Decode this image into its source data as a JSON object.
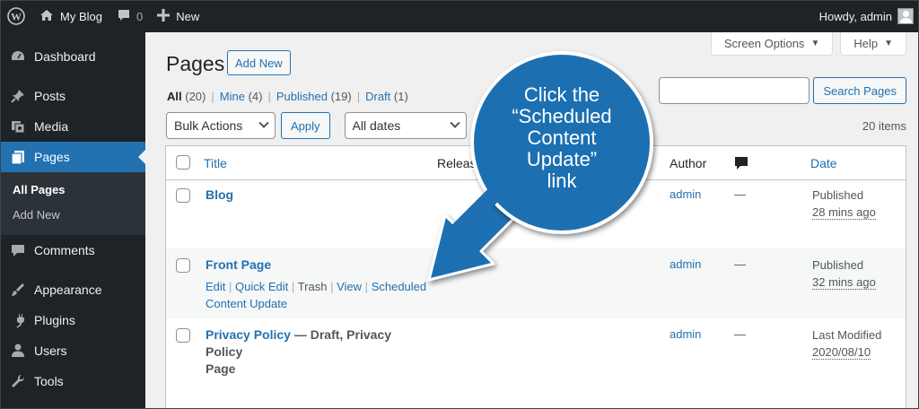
{
  "adminbar": {
    "site_name": "My Blog",
    "comments_count": "0",
    "new_label": "New",
    "howdy": "Howdy, admin"
  },
  "sidebar": {
    "items": [
      {
        "label": "Dashboard",
        "icon": "dashboard-icon"
      },
      {
        "label": "Posts",
        "icon": "pin-icon"
      },
      {
        "label": "Media",
        "icon": "media-icon"
      },
      {
        "label": "Pages",
        "icon": "pages-icon"
      },
      {
        "label": "Comments",
        "icon": "comment-icon"
      },
      {
        "label": "Appearance",
        "icon": "brush-icon"
      },
      {
        "label": "Plugins",
        "icon": "plug-icon"
      },
      {
        "label": "Users",
        "icon": "users-icon"
      },
      {
        "label": "Tools",
        "icon": "wrench-icon"
      }
    ],
    "submenu": [
      "All Pages",
      "Add New"
    ]
  },
  "header": {
    "screen_options": "Screen Options",
    "help": "Help",
    "title": "Pages",
    "add_new": "Add New"
  },
  "filters": {
    "all": "All",
    "all_count": "(20)",
    "mine": "Mine",
    "mine_count": "(4)",
    "published": "Published",
    "published_count": "(19)",
    "draft": "Draft",
    "draft_count": "(1)",
    "separator": "|"
  },
  "search": {
    "value": "",
    "button": "Search Pages"
  },
  "tablenav": {
    "bulk_actions": "Bulk Actions",
    "apply": "Apply",
    "dates": "All dates",
    "items": "20 items"
  },
  "table": {
    "headers": {
      "title": "Title",
      "release": "Release",
      "author": "Author",
      "date": "Date"
    },
    "rows": [
      {
        "title": "Blog",
        "state": "",
        "author": "admin",
        "comments": "—",
        "date_status": "Published",
        "date_value": "28 mins ago"
      },
      {
        "title": "Front Page",
        "state": "",
        "author": "admin",
        "comments": "—",
        "date_status": "Published",
        "date_value": "32 mins ago",
        "actions": {
          "edit": "Edit",
          "quick_edit": "Quick Edit",
          "trash": "Trash",
          "view": "View",
          "scheduled": "Scheduled",
          "scheduled_2": "Content Update",
          "sep": "|"
        }
      },
      {
        "title": "Privacy Policy",
        "state": " — Draft, Privacy Policy",
        "state_2": "Page",
        "author": "admin",
        "comments": "—",
        "date_status": "Last Modified",
        "date_value": "2020/08/10"
      }
    ]
  },
  "callout": {
    "line1": "Click the",
    "line2": "“Scheduled",
    "line3": "Content",
    "line4": "Update”",
    "line5": "link",
    "color": "#1f6fb2"
  }
}
